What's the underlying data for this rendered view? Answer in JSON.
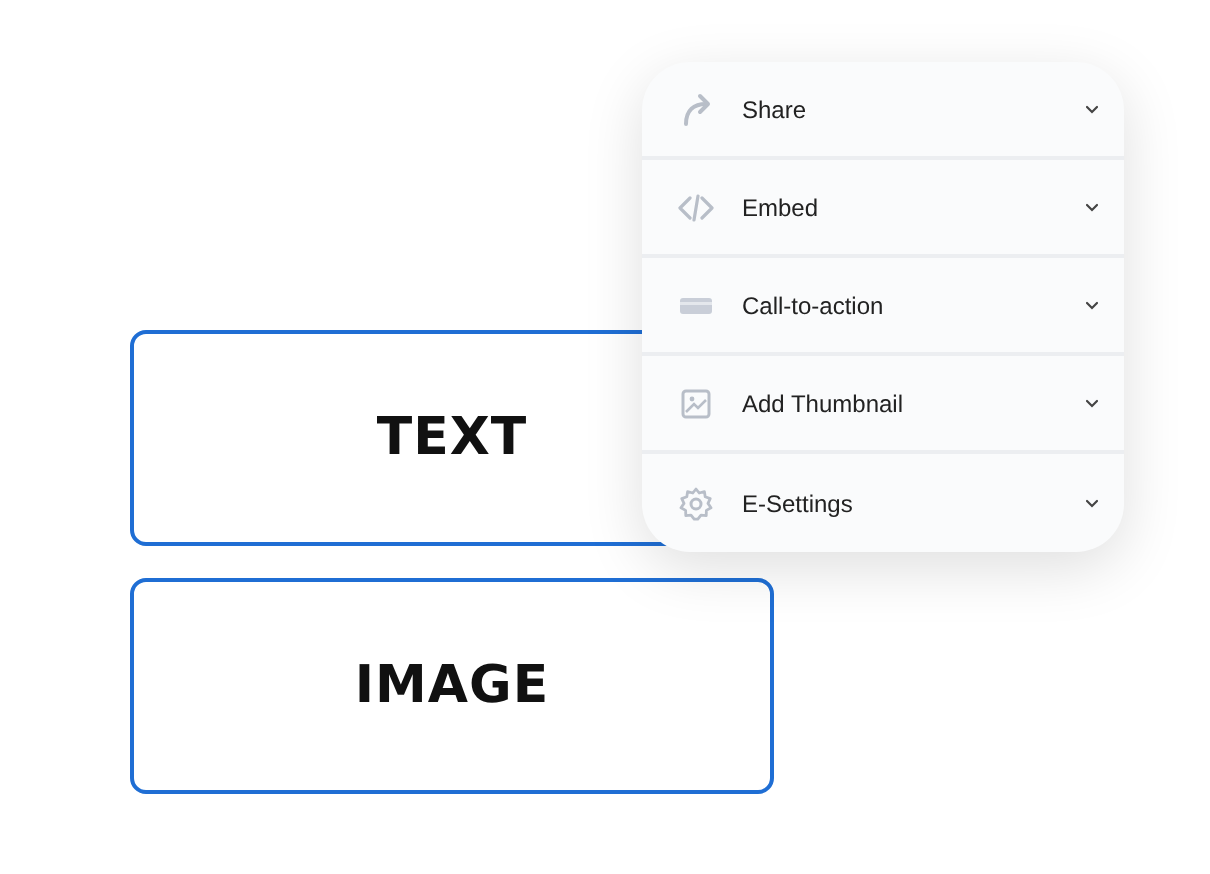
{
  "blocks": [
    {
      "label": "TEXT"
    },
    {
      "label": "IMAGE"
    }
  ],
  "menu": {
    "items": [
      {
        "label": "Share",
        "expanded": false
      },
      {
        "label": "Embed",
        "expanded": false
      },
      {
        "label": "Call-to-action",
        "expanded": false
      },
      {
        "label": "Add Thumbnail",
        "expanded": false
      },
      {
        "label": "E-Settings",
        "expanded": false
      }
    ]
  }
}
